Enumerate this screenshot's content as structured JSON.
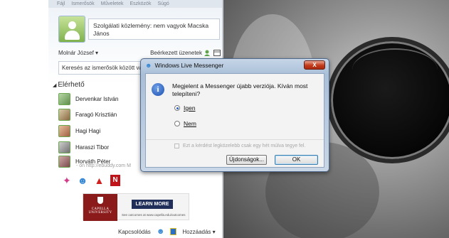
{
  "menubar": [
    "Fájl",
    "Ismerősök",
    "Műveletek",
    "Eszközök",
    "Súgó"
  ],
  "profile": {
    "status_message": "Szolgálati közlemény: nem vagyok Macska János"
  },
  "user_row": {
    "name": "Molnár József ▾",
    "inbox": "Beérkezett üzenetek"
  },
  "search": {
    "placeholder": "Keresés az ismerősök között vagy"
  },
  "group": {
    "label": "Elérhető"
  },
  "contacts": [
    {
      "name": "Dervenkar István"
    },
    {
      "name": "Faragó Krisztián"
    },
    {
      "name": "Hagi Hagi"
    },
    {
      "name": "Haraszi Tibor"
    },
    {
      "name": "Horváth Péter",
      "sub": "- on http://ebuddy.com M"
    }
  ],
  "ad": {
    "logo_text": "CAPELLA UNIVERSITY",
    "button": "LEARN MORE",
    "fine_print": "See outcomes at www.capella.edu/outcomes"
  },
  "bottombar": {
    "connect": "Kapcsolódás",
    "add": "Hozzáadás ▾"
  },
  "dialog": {
    "title": "Windows Live Messenger",
    "close": "X",
    "message": "Megjelent a Messenger újabb verziója. Kíván most telepíteni?",
    "option_yes": "Igen",
    "option_no": "Nem",
    "checkbox": "Ezt a kérdést legközelebb csak egy hét múlva tegye fel.",
    "options_button": "Újdonságok...",
    "ok_button": "OK",
    "selected": "yes"
  },
  "colors": {
    "dialog_frame": "#a9bfd8",
    "close_red": "#c23a1a",
    "accent_blue": "#2a60c0"
  }
}
